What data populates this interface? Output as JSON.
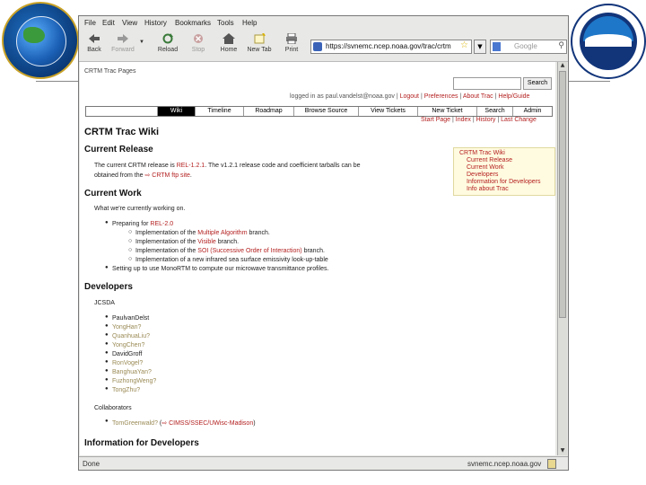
{
  "browser": {
    "menu": [
      "File",
      "Edit",
      "View",
      "History",
      "Bookmarks",
      "Tools",
      "Help"
    ],
    "toolbar": {
      "back": "Back",
      "forward": "Forward",
      "reload": "Reload",
      "stop": "Stop",
      "home": "Home",
      "new_tab": "New Tab",
      "print": "Print"
    },
    "url": "https://svnemc.ncep.noaa.gov/trac/crtm",
    "search_placeholder": "Google",
    "status_left": "Done",
    "status_right": "svnemc.ncep.noaa.gov"
  },
  "trac": {
    "project": "CRTM Trac Pages",
    "search_button": "Search",
    "meta": {
      "logged_in": "logged in as paul.vandelst@noaa.gov",
      "logout": "Logout",
      "preferences": "Preferences",
      "about": "About Trac",
      "help": "Help/Guide"
    },
    "nav": [
      "Wiki",
      "Timeline",
      "Roadmap",
      "Browse Source",
      "View Tickets",
      "New Ticket",
      "Search",
      "Admin"
    ],
    "subnav": [
      "Start Page",
      "Index",
      "History",
      "Last Change"
    ],
    "title": "CRTM Trac Wiki",
    "toc": [
      "CRTM Trac Wiki",
      "Current Release",
      "Current Work",
      "Developers",
      "Information for Developers",
      "Info about Trac"
    ],
    "release": {
      "heading": "Current Release",
      "text_a": "The current CRTM release is",
      "rel_link": "REL-1.2.1",
      "text_b": ". The v1.2.1 release code and coefficient tarballs can be",
      "text_c": "obtained from the",
      "ftp_link": "CRTM ftp site"
    },
    "work": {
      "heading": "Current Work",
      "intro": "What we're currently working on.",
      "preparing": "Preparing for",
      "rel20": "REL-2.0",
      "sub": [
        {
          "pre": "Implementation of the",
          "link": "Multiple Algorithm",
          "post": "branch."
        },
        {
          "pre": "Implementation of the",
          "link": "Visible",
          "post": "branch."
        },
        {
          "pre": "Implementation of the",
          "link": "SOI (Successive Order of Interaction)",
          "post": "branch."
        },
        {
          "pre": "Implementation of a new infrared sea surface emissivity look-up-table",
          "link": "",
          "post": ""
        }
      ],
      "setup": "Setting up to use MonoRTM to compute our microwave transmittance profiles."
    },
    "developers": {
      "heading": "Developers",
      "group": "JCSDA",
      "people": [
        {
          "name": "PaulvanDelst",
          "missing": false
        },
        {
          "name": "YongHan?",
          "missing": true
        },
        {
          "name": "QuanhuaLiu?",
          "missing": true
        },
        {
          "name": "YongChen?",
          "missing": true
        },
        {
          "name": "DavidGroff",
          "missing": false
        },
        {
          "name": "RonVogel?",
          "missing": true
        },
        {
          "name": "BanghuaYan?",
          "missing": true
        },
        {
          "name": "FuzhongWeng?",
          "missing": true
        },
        {
          "name": "TongZhu?",
          "missing": true
        }
      ],
      "collab_label": "Collaborators",
      "collab_name": "TomGreenwald?",
      "collab_link": "CIMSS/SSEC/UWisc-Madison",
      "collab_close": ")"
    },
    "info_heading": "Information for Developers"
  },
  "colors": {
    "link": "#b42020",
    "missing_link": "#9a8a55",
    "toc_bg": "#fffbe0"
  }
}
